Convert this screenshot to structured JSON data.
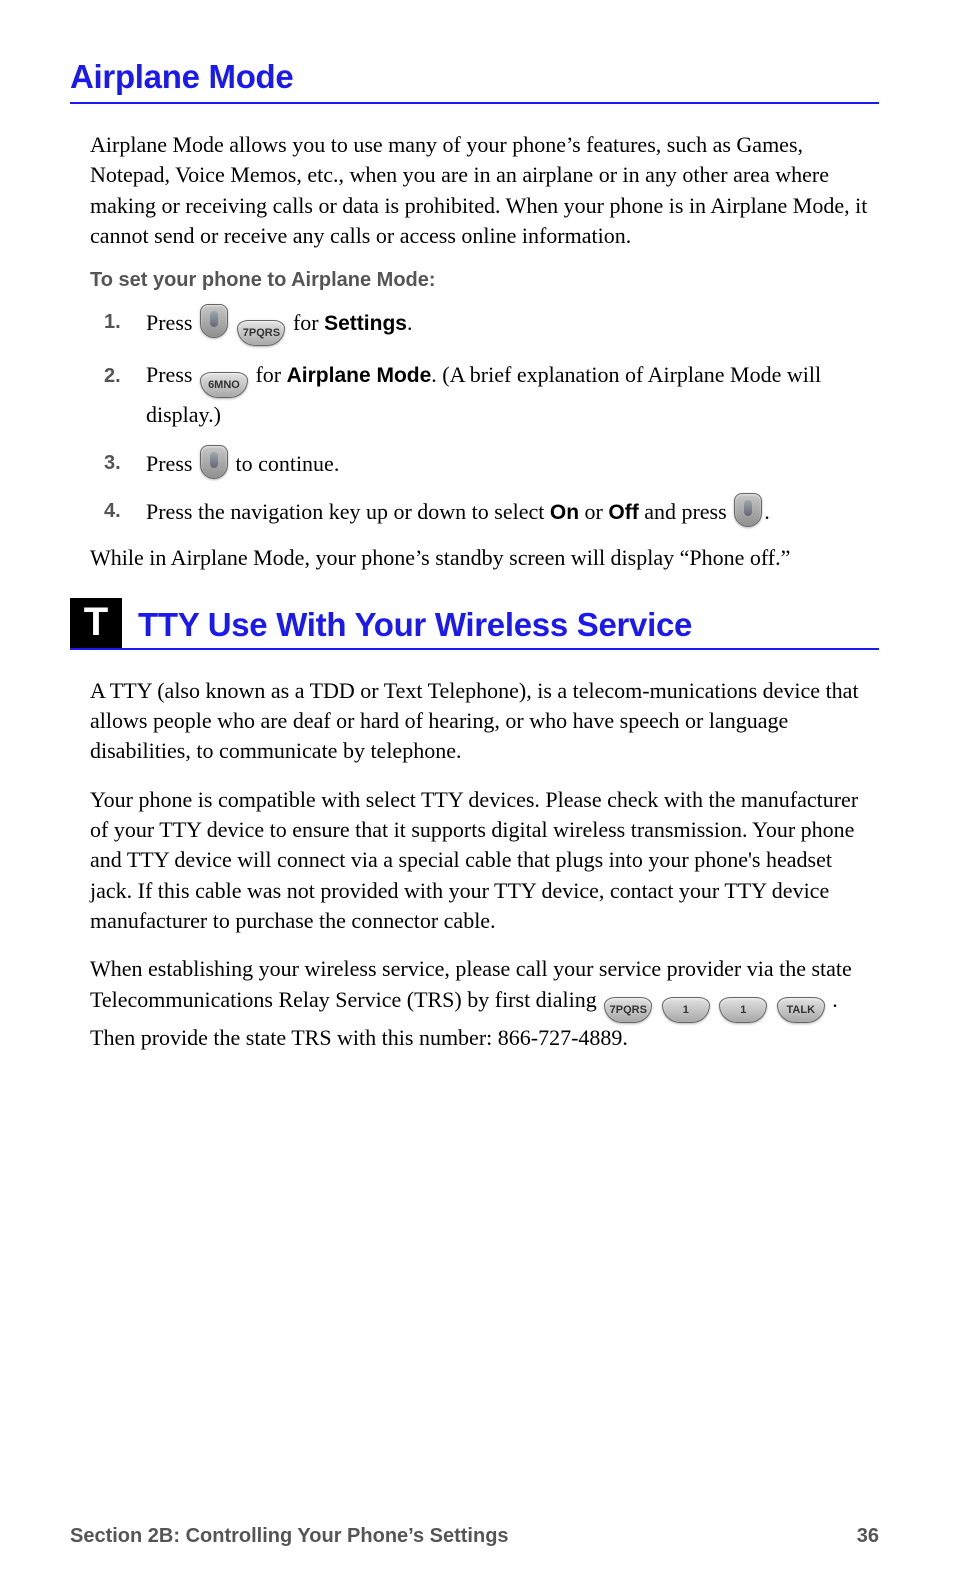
{
  "headings": {
    "airplane": "Airplane Mode",
    "tty": "TTY Use With Your Wireless Service",
    "tty_icon": "T"
  },
  "airplane": {
    "intro": "Airplane Mode allows you to use many of your phone’s features, such as Games, Notepad, Voice Memos, etc., when you are in an airplane or in any other area where making or receiving calls or data is prohibited. When your phone is in Airplane Mode, it cannot send or receive any calls or access online information.",
    "to_set": "To set your phone to Airplane Mode:",
    "steps": {
      "s1_a": "Press ",
      "s1_b": " for ",
      "s1_settings": "Settings",
      "s1_c": ".",
      "s2_a": "Press ",
      "s2_b": " for ",
      "s2_airplane": "Airplane Mode",
      "s2_c": ". (A brief explanation of Airplane Mode will display.)",
      "s3_a": "Press ",
      "s3_b": " to continue.",
      "s4_a": "Press the navigation key up or down to select ",
      "s4_on": "On",
      "s4_or": " or ",
      "s4_off": "Off",
      "s4_b": " and press ",
      "s4_c": "."
    },
    "outro": "While in Airplane Mode, your phone’s standby screen will display “Phone off.”"
  },
  "tty": {
    "p1": "A TTY (also known as a TDD or Text Telephone), is a telecom-munications device that allows people who are deaf or hard of hearing, or who have speech or language disabilities, to communicate by telephone.",
    "p2": "Your phone is compatible with select TTY devices. Please check with the manufacturer of your TTY device to ensure that it supports digital wireless transmission. Your phone and TTY device will connect via a special cable that plugs into your phone's headset jack. If this cable was not provided with your TTY device, contact your TTY device manufacturer to purchase the connector cable.",
    "p3_a": "When establishing your wireless service, please call your service provider via the state Telecommunications Relay Service (TRS) by first dialing ",
    "p3_b": ". Then provide the state TRS with this number: 866-727-4889."
  },
  "keys": {
    "seven": "7PQRS",
    "six": "6MNO",
    "one": "1",
    "talk": "TALK"
  },
  "footer": {
    "section": "Section 2B: Controlling Your Phone’s Settings",
    "page": "36"
  }
}
